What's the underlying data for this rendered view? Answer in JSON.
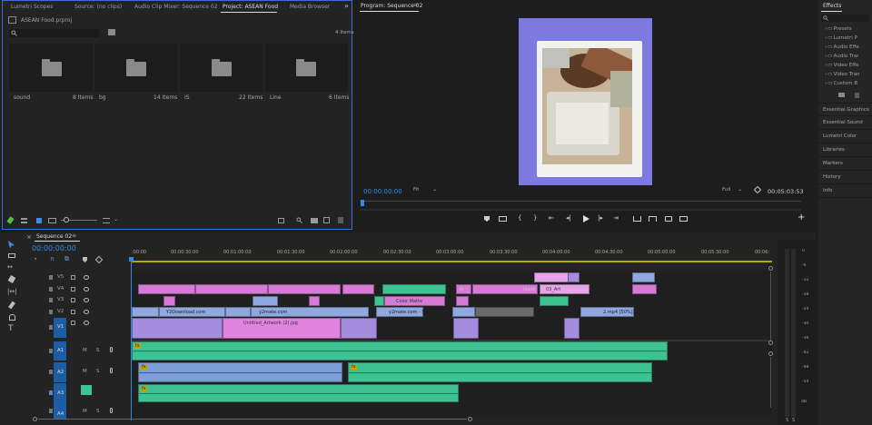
{
  "project_panel": {
    "tabs": [
      "Lumetri Scopes",
      "Source: (no clips)",
      "Audio Clip Mixer: Sequence 02",
      "Project: ASEAN Food",
      "Media Browser"
    ],
    "active_tab": "Project: ASEAN Food",
    "project_file": "ASEAN Food.prproj",
    "item_count": "4 Items",
    "search_placeholder": "",
    "bins": [
      {
        "name": "sound",
        "count": "8 Items"
      },
      {
        "name": "bg",
        "count": "14 Items"
      },
      {
        "name": "IS",
        "count": "22 Items"
      },
      {
        "name": "Line",
        "count": "6 Items"
      }
    ]
  },
  "program_monitor": {
    "title": "Program: Sequence 02",
    "timecode": "00:00:00:00",
    "fit": "Fit",
    "resolution": "Full",
    "duration": "00:05:03:53"
  },
  "right_panel": {
    "effects_title": "Effects",
    "effect_folders": [
      "Presets",
      "Lumetri P",
      "Audio Effe",
      "Audio Trar",
      "Video Effe",
      "Video Tran",
      "Custom B"
    ],
    "panels": [
      "Essential Graphics",
      "Essential Sound",
      "Lumetri Color",
      "Libraries",
      "Markers",
      "History",
      "Info"
    ]
  },
  "timeline": {
    "sequence_name": "Sequence 02",
    "timecode": "00:00:00:00",
    "ruler": [
      ":00:00",
      "00:00:30:00",
      "00:01:00:00",
      "00:01:30:00",
      "00:02:00:00",
      "00:02:30:00",
      "00:03:00:00",
      "00:03:30:00",
      "00:04:00:00",
      "00:04:30:00",
      "00:05:00:00",
      "00:05:30:00",
      "00:06:"
    ],
    "video_tracks": [
      "V5",
      "V4",
      "V3",
      "V2",
      "V1"
    ],
    "audio_tracks": [
      "A1",
      "A2",
      "A3",
      "A4"
    ],
    "track_buttons": {
      "mute": "M",
      "solo": "S"
    },
    "clip_labels": {
      "v4_a": "fx",
      "v4_b": "lease",
      "v4_c": "03_Art",
      "v3_a": "Color Matte",
      "v2_a": "Y2Download.com",
      "v2_b": "y2mate.com",
      "v2_c": "y2mate.com - Shri",
      "v2_d": "2.mp4 [50%]",
      "v1_a": "Untitled_Artwork (2).jpg",
      "a_fx": "fx"
    },
    "meter_scale": [
      "0",
      "-6",
      "-12",
      "-18",
      "-24",
      "-30",
      "-36",
      "-42",
      "-48",
      "-54",
      "dB"
    ],
    "meter_footer": [
      "S",
      "S"
    ]
  },
  "colors": {
    "accent_blue": "#2d8ceb",
    "panel_border": "#3a6fd6",
    "clip_pink": "#d67ad6",
    "clip_pink_light": "#e6a5e8",
    "clip_blue": "#8fa8e0",
    "clip_purple": "#a48ddf",
    "clip_teal": "#3fc293",
    "clip_audio_blue": "#7e9ed8",
    "frame_bg": "#7c7ae0"
  }
}
